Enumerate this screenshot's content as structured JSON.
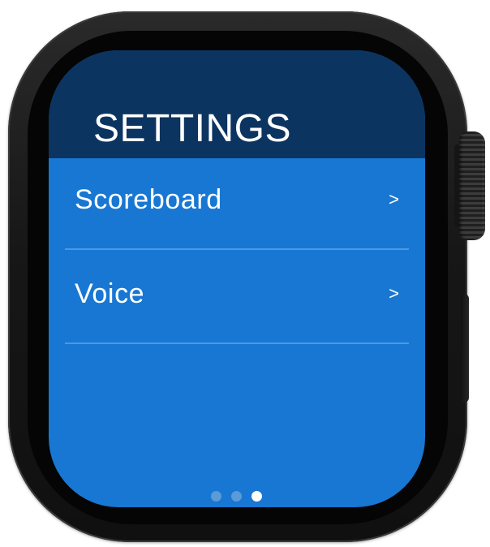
{
  "header": {
    "title": "SETTINGS"
  },
  "menu": {
    "items": [
      {
        "label": "Scoreboard",
        "chevron": ">"
      },
      {
        "label": "Voice",
        "chevron": ">"
      }
    ]
  },
  "pagination": {
    "total_pages": 3,
    "current_page": 3
  },
  "colors": {
    "screen_background": "#1877d2",
    "header_background": "#0c3460",
    "divider": "#4a9ae5",
    "inactive_dot": "#5a9bd8",
    "active_dot": "#ffffff",
    "text": "#ffffff"
  },
  "icons": {
    "row_chevron": "chevron-right-icon"
  }
}
